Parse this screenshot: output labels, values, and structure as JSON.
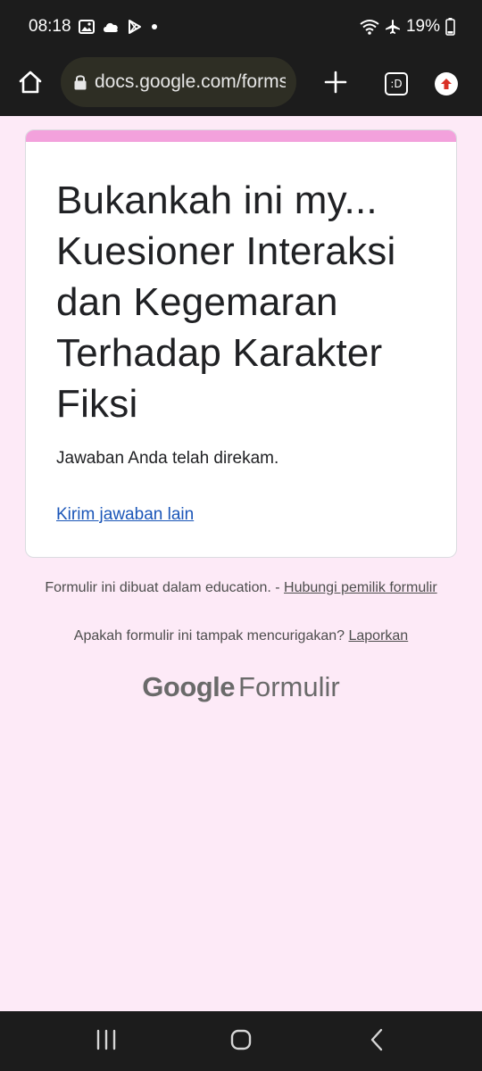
{
  "status_bar": {
    "time": "08:18",
    "battery": "19%"
  },
  "browser": {
    "url": "docs.google.com/forms",
    "tab_count": ":D"
  },
  "form": {
    "title": "Bukankah ini my... Kuesioner Interaksi dan Kegemaran Terhadap Karakter Fiksi",
    "confirmation": "Jawaban Anda telah direkam.",
    "resend_link": "Kirim jawaban lain"
  },
  "footer": {
    "created_text": "Formulir ini dibuat dalam education. - ",
    "contact_owner_link": "Hubungi pemilik formulir",
    "suspicious_text": "Apakah formulir ini tampak mencurigakan? ",
    "report_link": "Laporkan",
    "brand_google": "Google",
    "brand_formulir": "Formulir"
  },
  "colors": {
    "page_background": "#fdeaf7",
    "card_accent": "#f3a1dc",
    "link": "#1a55b8",
    "system_bar": "#1c1c1c"
  }
}
